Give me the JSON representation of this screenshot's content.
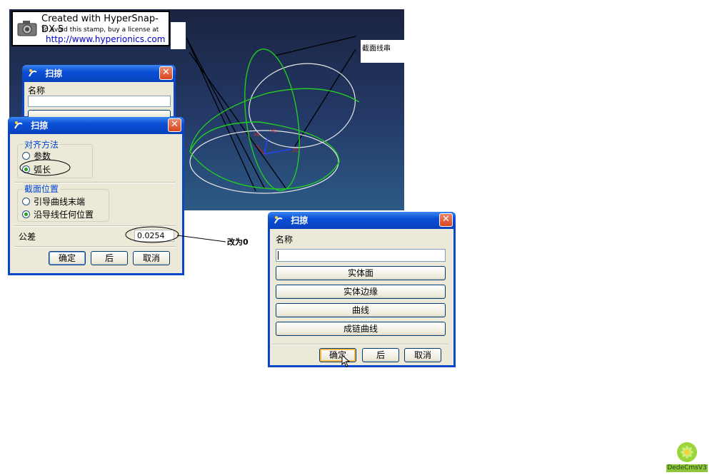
{
  "stamp": {
    "line1": "Created with HyperSnap-DX 5",
    "line2": "To avoid this stamp, buy a license at",
    "url": "http://www.hyperionics.com"
  },
  "viewport": {
    "callout_label": "截面线串"
  },
  "dialog_back": {
    "title": "扫掠",
    "name_label": "名称"
  },
  "dialog_main": {
    "title": "扫掠",
    "align_group": "对齐方法",
    "align_options": [
      "参数",
      "弧长"
    ],
    "section_group": "截面位置",
    "section_options": [
      "引导曲线末端",
      "沿导线任何位置"
    ],
    "tolerance_label": "公差",
    "tolerance_value": "0.0254",
    "ok": "确定",
    "back": "后",
    "cancel": "取消"
  },
  "annotation": {
    "text": "改为0"
  },
  "dialog_right": {
    "title": "扫掠",
    "name_label": "名称",
    "name_value": "",
    "buttons": [
      "实体面",
      "实体边缘",
      "曲线",
      "成链曲线"
    ],
    "ok": "确定",
    "back": "后",
    "cancel": "取消"
  },
  "logo": {
    "text": "DedeCmsV3"
  }
}
